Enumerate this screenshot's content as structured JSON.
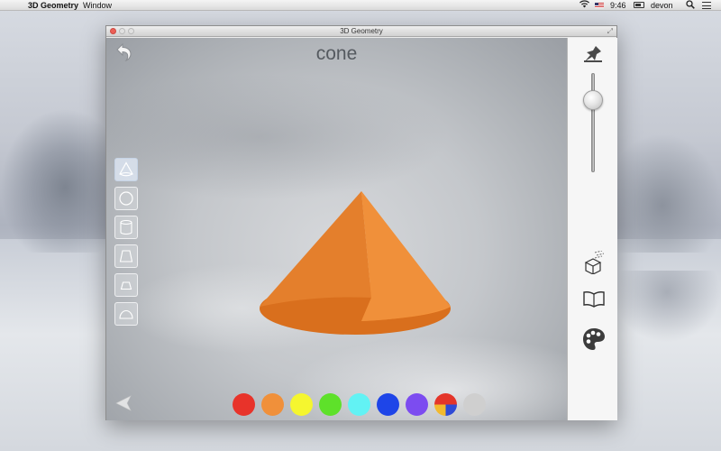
{
  "menubar": {
    "apple_glyph": "",
    "app_name": "3D Geometry",
    "menus": [
      "Window"
    ],
    "time": "9:46",
    "user": "devon",
    "status_icons": [
      "wifi-icon",
      "us-flag-icon",
      "battery-icon",
      "spotlight-icon",
      "notification-list-icon"
    ]
  },
  "window": {
    "title": "3D Geometry"
  },
  "canvas": {
    "shape_name": "cone",
    "shape_color": "#F0903A",
    "shape_tools": [
      {
        "name": "cone",
        "icon": "cone-icon",
        "selected": true
      },
      {
        "name": "sphere",
        "icon": "sphere-icon",
        "selected": false
      },
      {
        "name": "cylinder",
        "icon": "cylinder-icon",
        "selected": false
      },
      {
        "name": "frustum",
        "icon": "frustum-icon",
        "selected": false
      },
      {
        "name": "trapezoid prism",
        "icon": "trapezoid-icon",
        "selected": false
      },
      {
        "name": "hemisphere",
        "icon": "hemisphere-icon",
        "selected": false
      }
    ],
    "colors": [
      "#E8332A",
      "#F0903A",
      "#F5F62F",
      "#5EE12A",
      "#62F2F4",
      "#1E45E8",
      "#7C4CF0",
      "multicolor",
      "#CFCFCF"
    ]
  },
  "panel": {
    "zoom_level": 0.22,
    "buttons": [
      "pin-icon",
      "cube-icon",
      "book-icon",
      "palette-icon"
    ]
  }
}
